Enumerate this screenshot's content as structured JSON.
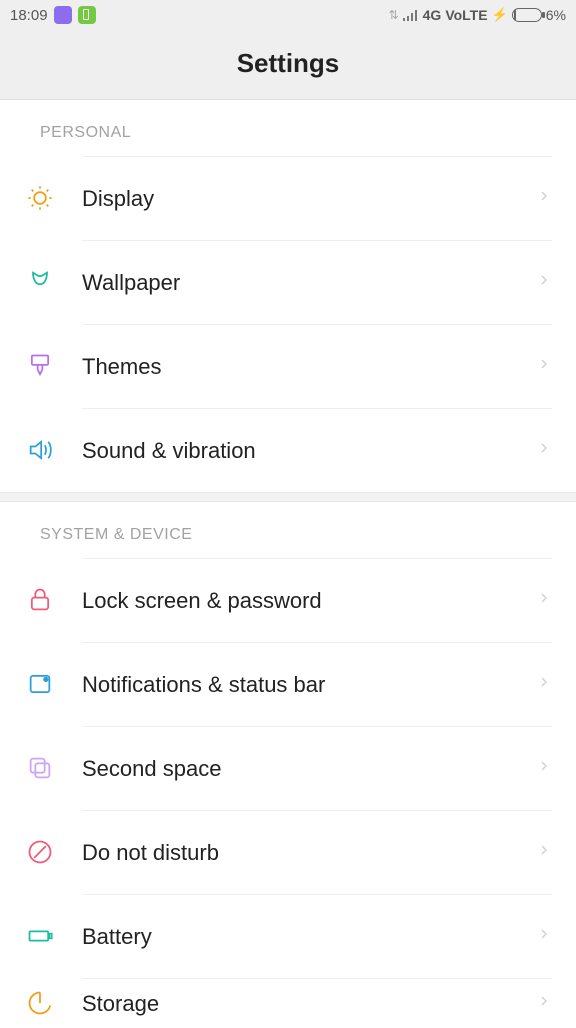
{
  "status": {
    "time": "18:09",
    "network": "4G",
    "volte": "VoLTE",
    "battery_pct": "6%"
  },
  "header": {
    "title": "Settings"
  },
  "sections": {
    "personal": {
      "label": "PERSONAL",
      "items": {
        "display": {
          "label": "Display"
        },
        "wallpaper": {
          "label": "Wallpaper"
        },
        "themes": {
          "label": "Themes"
        },
        "sound": {
          "label": "Sound & vibration"
        }
      }
    },
    "system": {
      "label": "SYSTEM & DEVICE",
      "items": {
        "lock": {
          "label": "Lock screen & password"
        },
        "notif": {
          "label": "Notifications & status bar"
        },
        "second": {
          "label": "Second space"
        },
        "dnd": {
          "label": "Do not disturb"
        },
        "battery": {
          "label": "Battery"
        },
        "storage": {
          "label": "Storage"
        }
      }
    }
  }
}
